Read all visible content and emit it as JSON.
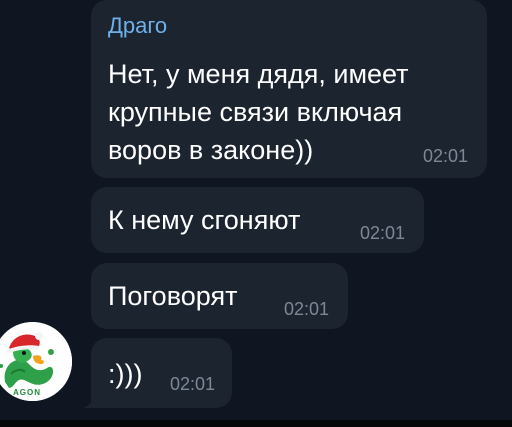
{
  "chat": {
    "messages": [
      {
        "sender": "Драго",
        "lines": [
          "Нет, у меня дядя, имеет",
          "крупные связи включая",
          "воров в законе))"
        ],
        "time": "02:01"
      },
      {
        "text": "К нему сгоняют",
        "time": "02:01"
      },
      {
        "text": "Поговорят",
        "time": "02:01"
      },
      {
        "text": ":)))",
        "time": "02:01"
      }
    ],
    "avatar": {
      "icon": "dragon-santa-hat-avatar",
      "caption": "AGON"
    }
  },
  "colors": {
    "background": "#0f1621",
    "bubble": "#1c2430",
    "sender_name": "#6fb0ea",
    "message_text": "#ffffff",
    "timestamp": "#7d8896"
  }
}
